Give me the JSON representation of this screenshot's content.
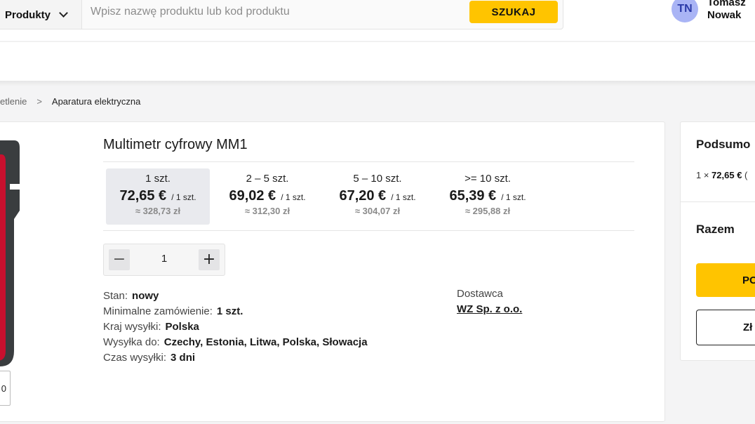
{
  "header": {
    "products_dropdown_label": "Produkty",
    "search_placeholder": "Wpisz nazwę produktu lub kod produktu",
    "search_button": "SZUKAJ",
    "user_initials": "TN",
    "user_first_name": "Tomasz",
    "user_last_name": "Nowak",
    "accent_color": "#ffc400"
  },
  "breadcrumb": {
    "items": [
      "etlenie",
      "Aparatura elektryczna"
    ],
    "separator": ">"
  },
  "product": {
    "title": "Multimetr cyfrowy MM1",
    "thumb_text": "0",
    "price_tiers": [
      {
        "qty": "1 szt.",
        "price": "72,65 €",
        "unit": "/ 1 szt.",
        "pln": "≈ 328,73 zł",
        "selected": true
      },
      {
        "qty": "2 – 5 szt.",
        "price": "69,02 €",
        "unit": "/ 1 szt.",
        "pln": "≈ 312,30 zł",
        "selected": false
      },
      {
        "qty": "5 – 10 szt.",
        "price": "67,20 €",
        "unit": "/ 1 szt.",
        "pln": "≈ 304,07 zł",
        "selected": false
      },
      {
        "qty": ">= 10 szt.",
        "price": "65,39 €",
        "unit": "/ 1 szt.",
        "pln": "≈ 295,88 zł",
        "selected": false
      }
    ],
    "quantity": "1",
    "minus_symbol": "−",
    "plus_symbol": "+",
    "attributes": [
      {
        "label": "Stan:",
        "value": "nowy"
      },
      {
        "label": "Minimalne zamówienie:",
        "value": "1 szt."
      },
      {
        "label": "Kraj wysyłki:",
        "value": "Polska"
      },
      {
        "label": "Wysyłka do:",
        "value": "Czechy, Estonia, Litwa, Polska, Słowacja"
      },
      {
        "label": "Czas wysyłki:",
        "value": "3 dni"
      }
    ],
    "supplier_label": "Dostawca",
    "supplier_name": "WZ Sp. z o.o."
  },
  "summary": {
    "title": "Podsumo",
    "line_prefix": "1 × ",
    "line_price": "72,65 €",
    "line_suffix": " (",
    "total_label": "Razem",
    "primary_button": "PO",
    "secondary_button": "Zł"
  }
}
